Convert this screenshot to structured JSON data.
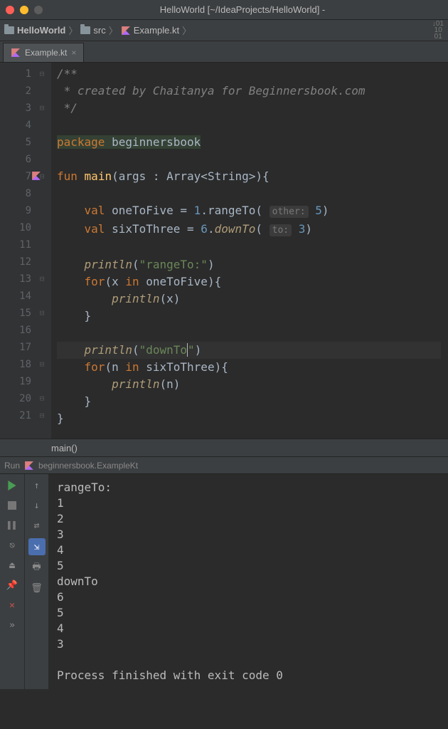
{
  "titlebar": {
    "title": "HelloWorld [~/IdeaProjects/HelloWorld] -"
  },
  "breadcrumb": {
    "project": "HelloWorld",
    "folder": "src",
    "file": "Example.kt"
  },
  "tab": {
    "name": "Example.kt"
  },
  "code": {
    "lines": [
      "1",
      "2",
      "3",
      "4",
      "5",
      "6",
      "7",
      "8",
      "9",
      "10",
      "11",
      "12",
      "13",
      "14",
      "15",
      "16",
      "17",
      "18",
      "19",
      "20",
      "21"
    ],
    "l1": "/**",
    "l2": " * created by Chaitanya for Beginnersbook.com",
    "l3": " */",
    "l5_kw": "package",
    "l5_pkg": "beginnersbook",
    "l7_fun": "fun",
    "l7_name": "main",
    "l7_sig": "(args : Array<String>){",
    "l9_val": "val",
    "l9_a": " oneToFive = ",
    "l9_n1": "1",
    "l9_b": ".rangeTo(",
    "l9_hint": "other:",
    "l9_n2": "5",
    "l9_c": ")",
    "l10_val": "val",
    "l10_a": " sixToThree = ",
    "l10_n1": "6",
    "l10_b": ".",
    "l10_fn": "downTo",
    "l10_c": "(",
    "l10_hint": "to:",
    "l10_n2": "3",
    "l10_d": ")",
    "l12_fn": "println",
    "l12_s": "\"rangeTo:\"",
    "l13_for": "for",
    "l13_a": "(x ",
    "l13_in": "in",
    "l13_b": " oneToFive){",
    "l14_fn": "println",
    "l14_a": "(x)",
    "l15": "}",
    "l17_fn": "println",
    "l17_s1": "\"downTo",
    "l17_s2": "\"",
    "l18_for": "for",
    "l18_a": "(n ",
    "l18_in": "in",
    "l18_b": " sixToThree){",
    "l19_fn": "println",
    "l19_a": "(n)",
    "l20": "}",
    "l21": "}"
  },
  "structure": {
    "context": "main()"
  },
  "run": {
    "label": "Run",
    "config": "beginnersbook.ExampleKt",
    "output": "rangeTo:\n1\n2\n3\n4\n5\ndownTo\n6\n5\n4\n3\n\nProcess finished with exit code 0"
  }
}
